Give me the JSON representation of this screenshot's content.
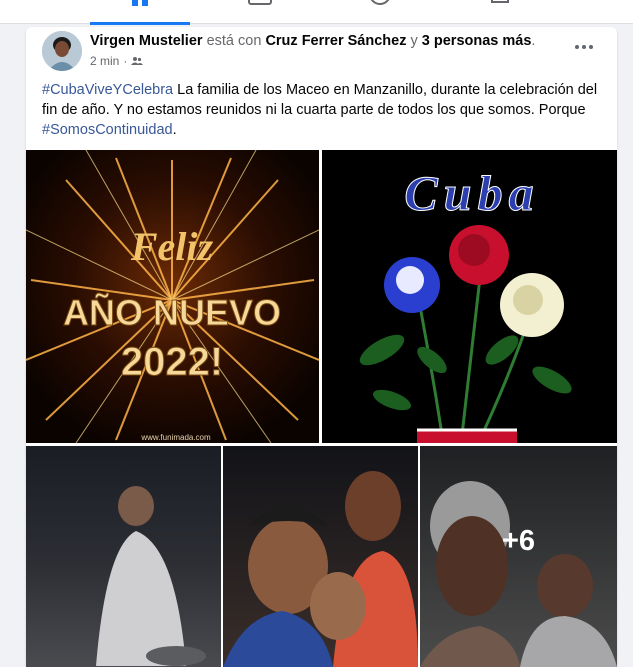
{
  "post": {
    "author": "Virgen Mustelier",
    "with_word": "está con",
    "tagged": "Cruz Ferrer Sánchez",
    "and_word": "y",
    "others": "3 personas más",
    "period": ".",
    "time": "2 min",
    "dot": "·",
    "privacy_icon": "friends-icon",
    "text_hashtag1": "#CubaViveYCelebra",
    "text_body": " La familia de los Maceo en Manzanillo, durante la celebración del fin de año. Y no estamos reunidos  ni la cuarta parte de todos los que somos. Porque ",
    "text_hashtag2": "#SomosContinuidad",
    "text_end": "."
  },
  "photos": {
    "p1": {
      "line1": "Feliz",
      "line2": "AÑO NUEVO",
      "line3": "2022!",
      "credit": "www.funimada.com"
    },
    "p2": {
      "word": "Cuba"
    },
    "more_count": "+6"
  },
  "colors": {
    "accent": "#1877f2",
    "link": "#385898",
    "text": "#050505",
    "secondary": "#65676b"
  }
}
